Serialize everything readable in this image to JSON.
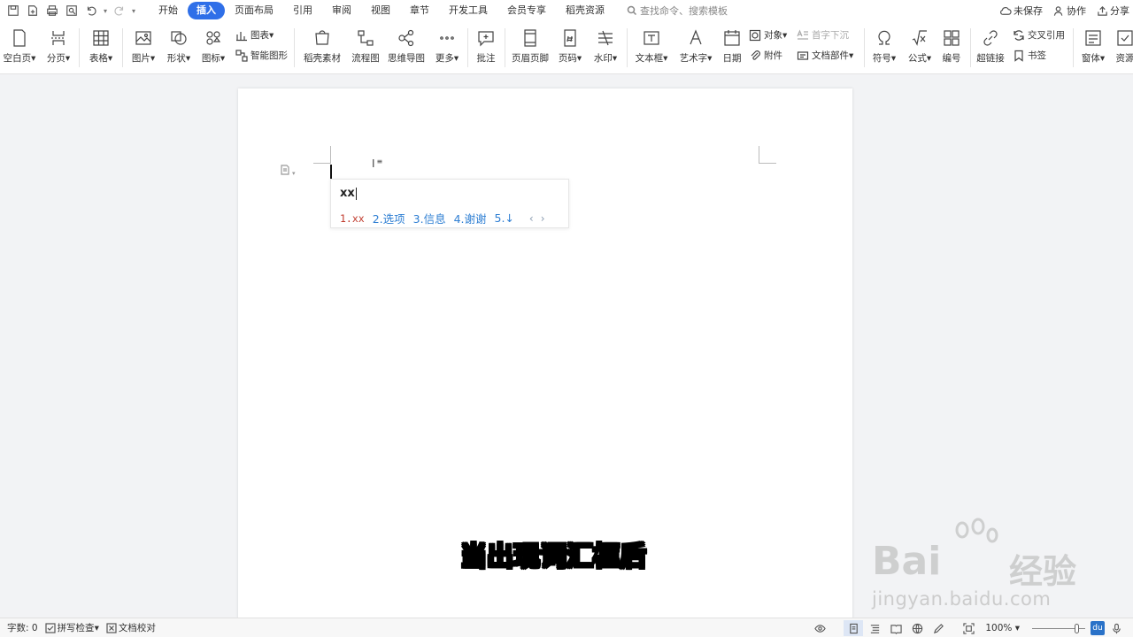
{
  "menubar": {
    "quick_icons": [
      "save-icon",
      "new-doc-icon",
      "print-icon",
      "print-preview-icon",
      "undo-icon",
      "redo-icon",
      "customize-icon"
    ],
    "tabs": [
      {
        "label": "开始",
        "active": false
      },
      {
        "label": "插入",
        "active": true
      },
      {
        "label": "页面布局",
        "active": false
      },
      {
        "label": "引用",
        "active": false
      },
      {
        "label": "审阅",
        "active": false
      },
      {
        "label": "视图",
        "active": false
      },
      {
        "label": "章节",
        "active": false
      },
      {
        "label": "开发工具",
        "active": false
      },
      {
        "label": "会员专享",
        "active": false
      },
      {
        "label": "稻壳资源",
        "active": false
      }
    ],
    "search_placeholder": "查找命令、搜索模板",
    "right": {
      "unsaved": "未保存",
      "collab": "协作",
      "share": "分享"
    }
  },
  "ribbon": {
    "blank_page": "空白页",
    "page_break": "分页",
    "table": "表格",
    "picture": "图片",
    "shape": "形状",
    "icon": "图标",
    "chart": "图表",
    "smart_graphic": "智能图形",
    "docer_material": "稻壳素材",
    "flowchart": "流程图",
    "mind_map": "思维导图",
    "more": "更多",
    "comment": "批注",
    "header_footer": "页眉页脚",
    "page_number": "页码",
    "watermark": "水印",
    "text_box": "文本框",
    "word_art": "艺术字",
    "date": "日期",
    "object": "对象",
    "attachment": "附件",
    "drop_cap": "首字下沉",
    "doc_parts": "文档部件",
    "symbol": "符号",
    "formula": "公式",
    "numbering": "编号",
    "hyperlink": "超链接",
    "cross_ref": "交叉引用",
    "bookmark": "书签",
    "form": "窗体",
    "resources": "资源"
  },
  "document": {
    "ime_input": "xx",
    "candidates": [
      "1.xx",
      "2.选项",
      "3.信息",
      "4.谢谢",
      "5.↓"
    ],
    "nav_prev": "‹",
    "nav_next": "›"
  },
  "caption": "当出现词汇框后",
  "watermark": {
    "brand": "Bai",
    "brand2": "经验",
    "url": "jingyan.baidu.com",
    "du": "du"
  },
  "statusbar": {
    "word_count": "字数: 0",
    "spell_check": "拼写检查",
    "doc_proof": "文档校对",
    "zoom": "100%",
    "zoom_fraction": 0.5,
    "du_badge": "du"
  },
  "colors": {
    "accent": "#2f6fe8",
    "candidate": "#2f7fd3",
    "candidate_first": "#c0392b"
  }
}
